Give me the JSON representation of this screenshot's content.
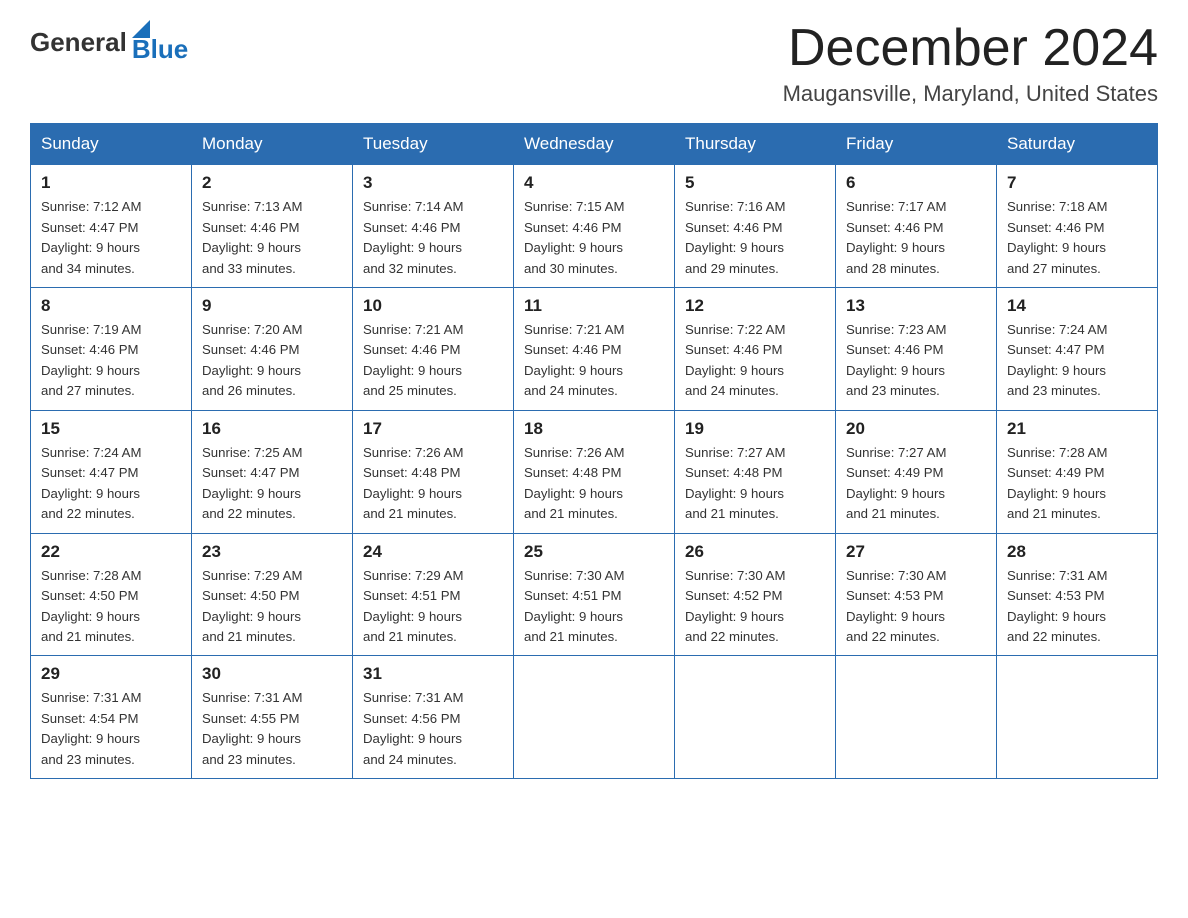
{
  "header": {
    "logo_general": "General",
    "logo_blue": "Blue",
    "month_title": "December 2024",
    "location": "Maugansville, Maryland, United States"
  },
  "weekdays": [
    "Sunday",
    "Monday",
    "Tuesday",
    "Wednesday",
    "Thursday",
    "Friday",
    "Saturday"
  ],
  "weeks": [
    [
      {
        "day": "1",
        "sunrise": "7:12 AM",
        "sunset": "4:47 PM",
        "daylight": "9 hours and 34 minutes."
      },
      {
        "day": "2",
        "sunrise": "7:13 AM",
        "sunset": "4:46 PM",
        "daylight": "9 hours and 33 minutes."
      },
      {
        "day": "3",
        "sunrise": "7:14 AM",
        "sunset": "4:46 PM",
        "daylight": "9 hours and 32 minutes."
      },
      {
        "day": "4",
        "sunrise": "7:15 AM",
        "sunset": "4:46 PM",
        "daylight": "9 hours and 30 minutes."
      },
      {
        "day": "5",
        "sunrise": "7:16 AM",
        "sunset": "4:46 PM",
        "daylight": "9 hours and 29 minutes."
      },
      {
        "day": "6",
        "sunrise": "7:17 AM",
        "sunset": "4:46 PM",
        "daylight": "9 hours and 28 minutes."
      },
      {
        "day": "7",
        "sunrise": "7:18 AM",
        "sunset": "4:46 PM",
        "daylight": "9 hours and 27 minutes."
      }
    ],
    [
      {
        "day": "8",
        "sunrise": "7:19 AM",
        "sunset": "4:46 PM",
        "daylight": "9 hours and 27 minutes."
      },
      {
        "day": "9",
        "sunrise": "7:20 AM",
        "sunset": "4:46 PM",
        "daylight": "9 hours and 26 minutes."
      },
      {
        "day": "10",
        "sunrise": "7:21 AM",
        "sunset": "4:46 PM",
        "daylight": "9 hours and 25 minutes."
      },
      {
        "day": "11",
        "sunrise": "7:21 AM",
        "sunset": "4:46 PM",
        "daylight": "9 hours and 24 minutes."
      },
      {
        "day": "12",
        "sunrise": "7:22 AM",
        "sunset": "4:46 PM",
        "daylight": "9 hours and 24 minutes."
      },
      {
        "day": "13",
        "sunrise": "7:23 AM",
        "sunset": "4:46 PM",
        "daylight": "9 hours and 23 minutes."
      },
      {
        "day": "14",
        "sunrise": "7:24 AM",
        "sunset": "4:47 PM",
        "daylight": "9 hours and 23 minutes."
      }
    ],
    [
      {
        "day": "15",
        "sunrise": "7:24 AM",
        "sunset": "4:47 PM",
        "daylight": "9 hours and 22 minutes."
      },
      {
        "day": "16",
        "sunrise": "7:25 AM",
        "sunset": "4:47 PM",
        "daylight": "9 hours and 22 minutes."
      },
      {
        "day": "17",
        "sunrise": "7:26 AM",
        "sunset": "4:48 PM",
        "daylight": "9 hours and 21 minutes."
      },
      {
        "day": "18",
        "sunrise": "7:26 AM",
        "sunset": "4:48 PM",
        "daylight": "9 hours and 21 minutes."
      },
      {
        "day": "19",
        "sunrise": "7:27 AM",
        "sunset": "4:48 PM",
        "daylight": "9 hours and 21 minutes."
      },
      {
        "day": "20",
        "sunrise": "7:27 AM",
        "sunset": "4:49 PM",
        "daylight": "9 hours and 21 minutes."
      },
      {
        "day": "21",
        "sunrise": "7:28 AM",
        "sunset": "4:49 PM",
        "daylight": "9 hours and 21 minutes."
      }
    ],
    [
      {
        "day": "22",
        "sunrise": "7:28 AM",
        "sunset": "4:50 PM",
        "daylight": "9 hours and 21 minutes."
      },
      {
        "day": "23",
        "sunrise": "7:29 AM",
        "sunset": "4:50 PM",
        "daylight": "9 hours and 21 minutes."
      },
      {
        "day": "24",
        "sunrise": "7:29 AM",
        "sunset": "4:51 PM",
        "daylight": "9 hours and 21 minutes."
      },
      {
        "day": "25",
        "sunrise": "7:30 AM",
        "sunset": "4:51 PM",
        "daylight": "9 hours and 21 minutes."
      },
      {
        "day": "26",
        "sunrise": "7:30 AM",
        "sunset": "4:52 PM",
        "daylight": "9 hours and 22 minutes."
      },
      {
        "day": "27",
        "sunrise": "7:30 AM",
        "sunset": "4:53 PM",
        "daylight": "9 hours and 22 minutes."
      },
      {
        "day": "28",
        "sunrise": "7:31 AM",
        "sunset": "4:53 PM",
        "daylight": "9 hours and 22 minutes."
      }
    ],
    [
      {
        "day": "29",
        "sunrise": "7:31 AM",
        "sunset": "4:54 PM",
        "daylight": "9 hours and 23 minutes."
      },
      {
        "day": "30",
        "sunrise": "7:31 AM",
        "sunset": "4:55 PM",
        "daylight": "9 hours and 23 minutes."
      },
      {
        "day": "31",
        "sunrise": "7:31 AM",
        "sunset": "4:56 PM",
        "daylight": "9 hours and 24 minutes."
      },
      null,
      null,
      null,
      null
    ]
  ],
  "labels": {
    "sunrise": "Sunrise:",
    "sunset": "Sunset:",
    "daylight": "Daylight:"
  }
}
